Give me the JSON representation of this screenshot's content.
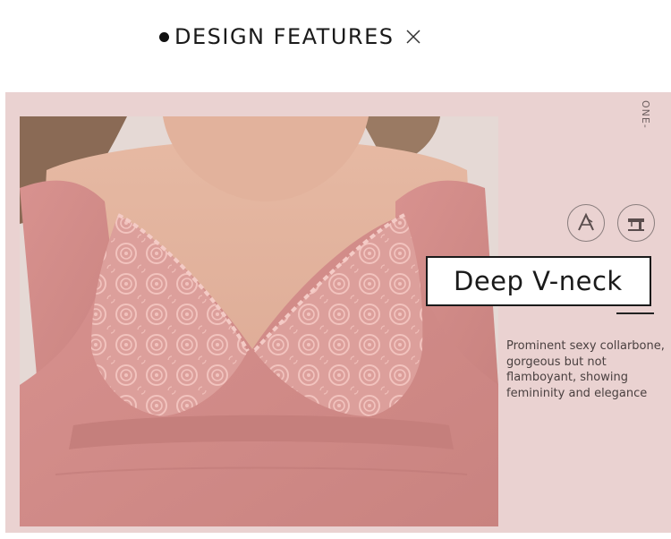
{
  "header": {
    "title": "DESIGN FEATURES"
  },
  "side_label": "ONE-",
  "feature": {
    "title": "Deep V-neck",
    "description": "Prominent sexy collarbone, gorgeous but not flamboyant, showing femininity and elegance"
  },
  "icons": [
    "fabric-cutting-icon",
    "sewing-machine-icon"
  ],
  "colors": {
    "panel_bg": "#ead2d1",
    "garment_pink": "#d99a97",
    "lace": "#eab3ae",
    "text_dark": "#1a1a1a"
  }
}
